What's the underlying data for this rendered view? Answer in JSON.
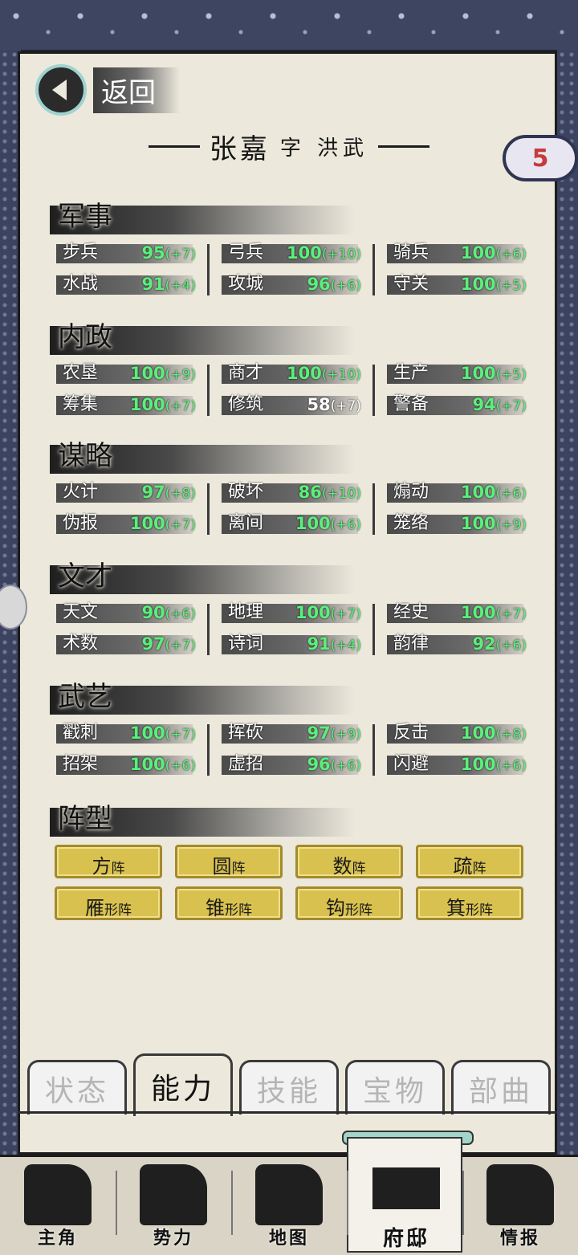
{
  "header": {
    "back_label": "返回",
    "name": "张嘉",
    "courtesy": "字 洪武",
    "badge": "5"
  },
  "sections": [
    {
      "title": "军事",
      "stats": [
        {
          "label": "步兵",
          "value": "95",
          "bonus": "(+7)"
        },
        {
          "label": "弓兵",
          "value": "100",
          "bonus": "(+10)"
        },
        {
          "label": "骑兵",
          "value": "100",
          "bonus": "(+6)"
        },
        {
          "label": "水战",
          "value": "91",
          "bonus": "(+4)"
        },
        {
          "label": "攻城",
          "value": "96",
          "bonus": "(+6)"
        },
        {
          "label": "守关",
          "value": "100",
          "bonus": "(+5)"
        }
      ]
    },
    {
      "title": "内政",
      "stats": [
        {
          "label": "农垦",
          "value": "100",
          "bonus": "(+9)"
        },
        {
          "label": "商才",
          "value": "100",
          "bonus": "(+10)"
        },
        {
          "label": "生产",
          "value": "100",
          "bonus": "(+5)"
        },
        {
          "label": "筹集",
          "value": "100",
          "bonus": "(+7)"
        },
        {
          "label": "修筑",
          "value": "58",
          "bonus": "(+7)"
        },
        {
          "label": "警备",
          "value": "94",
          "bonus": "(+7)"
        }
      ]
    },
    {
      "title": "谋略",
      "stats": [
        {
          "label": "火计",
          "value": "97",
          "bonus": "(+8)"
        },
        {
          "label": "破坏",
          "value": "86",
          "bonus": "(+10)"
        },
        {
          "label": "煽动",
          "value": "100",
          "bonus": "(+6)"
        },
        {
          "label": "伪报",
          "value": "100",
          "bonus": "(+7)"
        },
        {
          "label": "离间",
          "value": "100",
          "bonus": "(+6)"
        },
        {
          "label": "笼络",
          "value": "100",
          "bonus": "(+9)"
        }
      ]
    },
    {
      "title": "文才",
      "stats": [
        {
          "label": "天文",
          "value": "90",
          "bonus": "(+6)"
        },
        {
          "label": "地理",
          "value": "100",
          "bonus": "(+7)"
        },
        {
          "label": "经史",
          "value": "100",
          "bonus": "(+7)"
        },
        {
          "label": "术数",
          "value": "97",
          "bonus": "(+7)"
        },
        {
          "label": "诗词",
          "value": "91",
          "bonus": "(+4)"
        },
        {
          "label": "韵律",
          "value": "92",
          "bonus": "(+6)"
        }
      ]
    },
    {
      "title": "武艺",
      "stats": [
        {
          "label": "戳刺",
          "value": "100",
          "bonus": "(+7)"
        },
        {
          "label": "挥砍",
          "value": "97",
          "bonus": "(+9)"
        },
        {
          "label": "反击",
          "value": "100",
          "bonus": "(+8)"
        },
        {
          "label": "招架",
          "value": "100",
          "bonus": "(+6)"
        },
        {
          "label": "虚招",
          "value": "96",
          "bonus": "(+6)"
        },
        {
          "label": "闪避",
          "value": "100",
          "bonus": "(+6)"
        }
      ]
    }
  ],
  "formation": {
    "title": "阵型",
    "items": [
      {
        "big": "方",
        "small": "阵"
      },
      {
        "big": "圆",
        "small": "阵"
      },
      {
        "big": "数",
        "small": "阵"
      },
      {
        "big": "疏",
        "small": "阵"
      },
      {
        "big": "雁",
        "small": "形阵"
      },
      {
        "big": "锥",
        "small": "形阵"
      },
      {
        "big": "钩",
        "small": "形阵"
      },
      {
        "big": "箕",
        "small": "形阵"
      }
    ]
  },
  "tabs": [
    "状态",
    "能力",
    "技能",
    "宝物",
    "部曲"
  ],
  "active_tab": "能力",
  "nav": [
    "主角",
    "势力",
    "地图",
    "府邸",
    "情报"
  ],
  "active_nav": "府邸",
  "colors": {
    "stat_green": "#5af07a",
    "gold": "#d9c14f",
    "paper": "#ece8dc",
    "frame": "#2f3550"
  }
}
